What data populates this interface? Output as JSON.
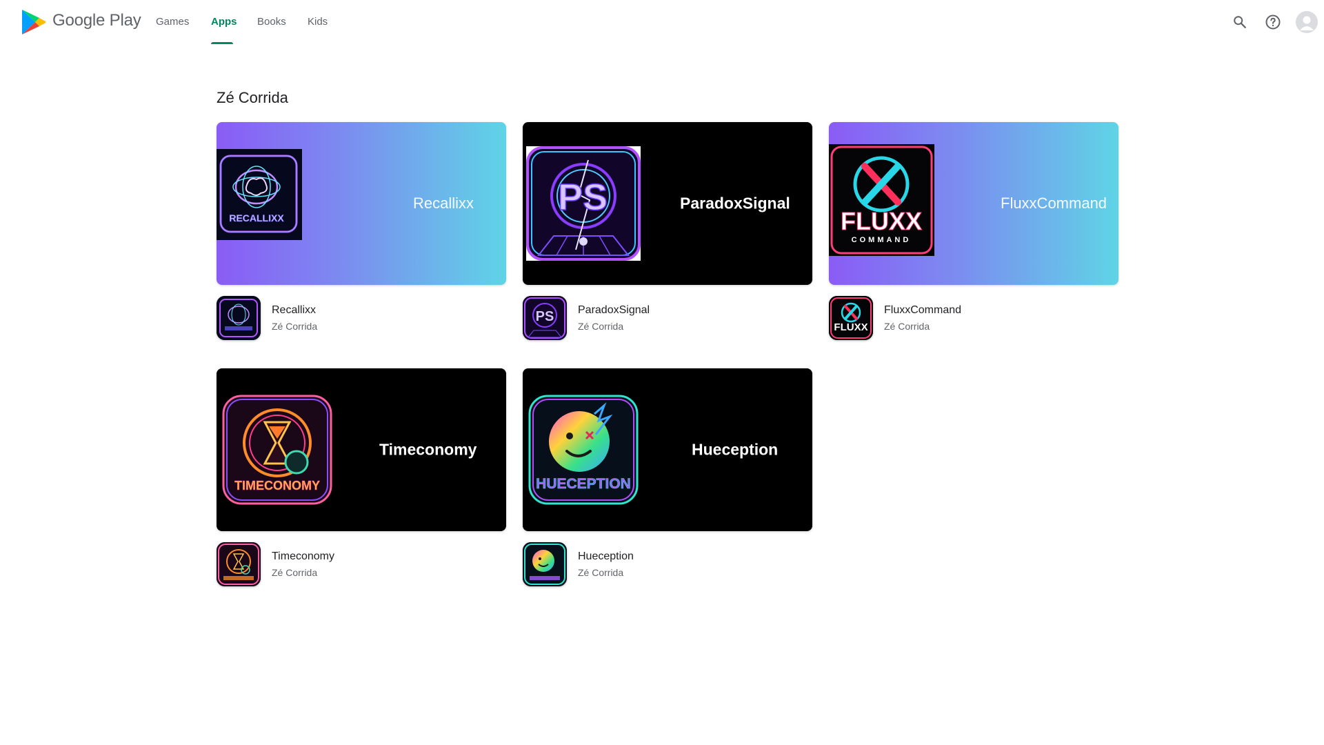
{
  "header": {
    "brand": "Google Play",
    "nav": [
      {
        "label": "Games",
        "active": false
      },
      {
        "label": "Apps",
        "active": true
      },
      {
        "label": "Books",
        "active": false
      },
      {
        "label": "Kids",
        "active": false
      }
    ],
    "icons": [
      "search-icon",
      "help-icon",
      "account-avatar"
    ],
    "accent_color": "#01875f"
  },
  "section": {
    "title": "Zé Corrida"
  },
  "apps": [
    {
      "name": "Recallixx",
      "developer": "Zé Corrida",
      "banner_title": "Recallixx",
      "banner_style": "gradient",
      "icon_text": "RECALLIXX"
    },
    {
      "name": "ParadoxSignal",
      "developer": "Zé Corrida",
      "banner_title": "ParadoxSignal",
      "banner_style": "dark",
      "icon_text": "PS"
    },
    {
      "name": "FluxxCommand",
      "developer": "Zé Corrida",
      "banner_title": "FluxxCommand",
      "banner_style": "gradient",
      "icon_text": "FLUXX",
      "icon_subtext": "COMMAND"
    },
    {
      "name": "Timeconomy",
      "developer": "Zé Corrida",
      "banner_title": "Timeconomy",
      "banner_style": "dark",
      "icon_text": "TIMECONOMY"
    },
    {
      "name": "Hueception",
      "developer": "Zé Corrida",
      "banner_title": "Hueception",
      "banner_style": "dark",
      "icon_text": "HUECEPTION"
    }
  ]
}
